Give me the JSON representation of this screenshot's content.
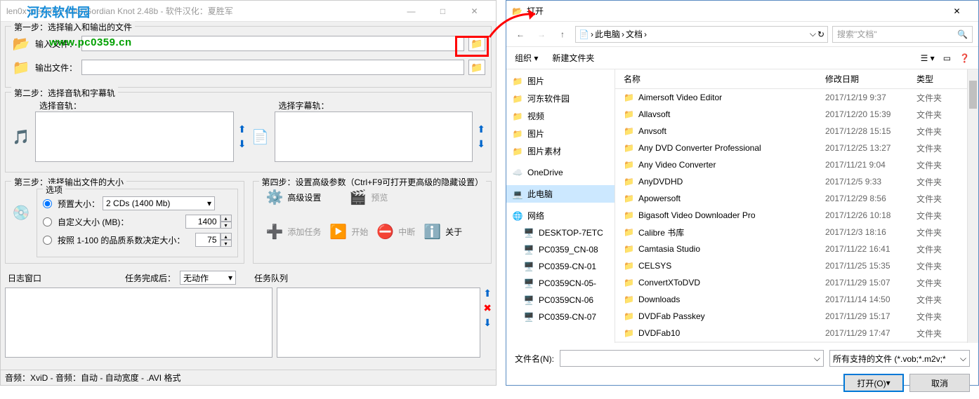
{
  "app": {
    "title": "len0x presents: Auto Gordian Knot 2.48b - 软件汉化：夏胜军",
    "step1": {
      "label": "第一步：选择输入和输出的文件",
      "input_label": "输入文件：",
      "output_label": "输出文件："
    },
    "step2": {
      "label": "第二步：选择音轨和字幕轨",
      "audio_label": "选择音轨：",
      "subtitle_label": "选择字幕轨："
    },
    "step3": {
      "label": "第三步：选择输出文件的大小",
      "options_label": "选项",
      "preset_label": "预置大小：",
      "preset_value": "2 CDs (1400 Mb)",
      "custom_label": "自定义大小 (MB)：",
      "custom_value": "1400",
      "quality_label": "按照 1-100 的品质系数决定大小：",
      "quality_value": "75"
    },
    "step4": {
      "label": "第四步：设置高级参数（Ctrl+F9可打开更高级的隐藏设置）",
      "advanced": "高级设置",
      "preview": "预览",
      "add_task": "添加任务",
      "start": "开始",
      "abort": "中断",
      "about": "关于"
    },
    "log_label": "日志窗口",
    "task_done_label": "任务完成后：",
    "task_done_value": "无动作",
    "queue_label": "任务队列",
    "statusbar": "音频：XviD - 音频：自动 - 自动宽度 - .AVI 格式"
  },
  "watermark": {
    "text": "河东软件园",
    "url": "www.pc0359.cn"
  },
  "dialog": {
    "title": "打开",
    "breadcrumb": {
      "root": "此电脑",
      "folder": "文档"
    },
    "search_placeholder": "搜索\"文档\"",
    "organize": "组织",
    "new_folder": "新建文件夹",
    "tree": [
      {
        "label": "图片",
        "type": "folder"
      },
      {
        "label": "河东软件园",
        "type": "folder"
      },
      {
        "label": "视频",
        "type": "folder"
      },
      {
        "label": "图片",
        "type": "folder"
      },
      {
        "label": "图片素材",
        "type": "folder"
      },
      {
        "label": "OneDrive",
        "type": "onedrive"
      },
      {
        "label": "此电脑",
        "type": "pc",
        "selected": true
      },
      {
        "label": "网络",
        "type": "network"
      },
      {
        "label": "DESKTOP-7ETC",
        "type": "computer"
      },
      {
        "label": "PC0359_CN-08",
        "type": "computer"
      },
      {
        "label": "PC0359-CN-01",
        "type": "computer"
      },
      {
        "label": "PC0359CN-05-",
        "type": "computer"
      },
      {
        "label": "PC0359CN-06",
        "type": "computer"
      },
      {
        "label": "PC0359-CN-07",
        "type": "computer"
      }
    ],
    "columns": {
      "name": "名称",
      "date": "修改日期",
      "type": "类型"
    },
    "files": [
      {
        "name": "Aimersoft Video Editor",
        "date": "2017/12/19 9:37",
        "type": "文件夹"
      },
      {
        "name": "Allavsoft",
        "date": "2017/12/20 15:39",
        "type": "文件夹"
      },
      {
        "name": "Anvsoft",
        "date": "2017/12/28 15:15",
        "type": "文件夹"
      },
      {
        "name": "Any DVD Converter Professional",
        "date": "2017/12/25 13:27",
        "type": "文件夹"
      },
      {
        "name": "Any Video Converter",
        "date": "2017/11/21 9:04",
        "type": "文件夹"
      },
      {
        "name": "AnyDVDHD",
        "date": "2017/12/5 9:33",
        "type": "文件夹"
      },
      {
        "name": "Apowersoft",
        "date": "2017/12/29 8:56",
        "type": "文件夹"
      },
      {
        "name": "Bigasoft Video Downloader Pro",
        "date": "2017/12/26 10:18",
        "type": "文件夹"
      },
      {
        "name": "Calibre 书库",
        "date": "2017/12/3 18:16",
        "type": "文件夹"
      },
      {
        "name": "Camtasia Studio",
        "date": "2017/11/22 16:41",
        "type": "文件夹"
      },
      {
        "name": "CELSYS",
        "date": "2017/11/25 15:35",
        "type": "文件夹"
      },
      {
        "name": "ConvertXToDVD",
        "date": "2017/11/29 15:07",
        "type": "文件夹"
      },
      {
        "name": "Downloads",
        "date": "2017/11/14 14:50",
        "type": "文件夹"
      },
      {
        "name": "DVDFab Passkey",
        "date": "2017/11/29 15:17",
        "type": "文件夹"
      },
      {
        "name": "DVDFab10",
        "date": "2017/11/29 17:47",
        "type": "文件夹"
      }
    ],
    "filename_label": "文件名(N):",
    "filter": "所有支持的文件 (*.vob;*.m2v;*",
    "open_btn": "打开(O)",
    "cancel_btn": "取消"
  }
}
